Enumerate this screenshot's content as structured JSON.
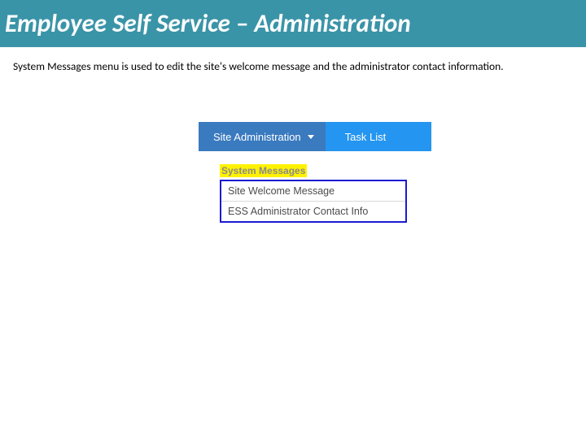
{
  "title": "Employee Self Service – Administration",
  "description": "System Messages menu is used to edit the site's welcome message and the administrator contact information.",
  "nav": {
    "site_admin": "Site Administration",
    "task_list": "Task List"
  },
  "menu": {
    "heading": "System Messages",
    "items": [
      "Site Welcome Message",
      "ESS Administrator Contact Info"
    ]
  }
}
